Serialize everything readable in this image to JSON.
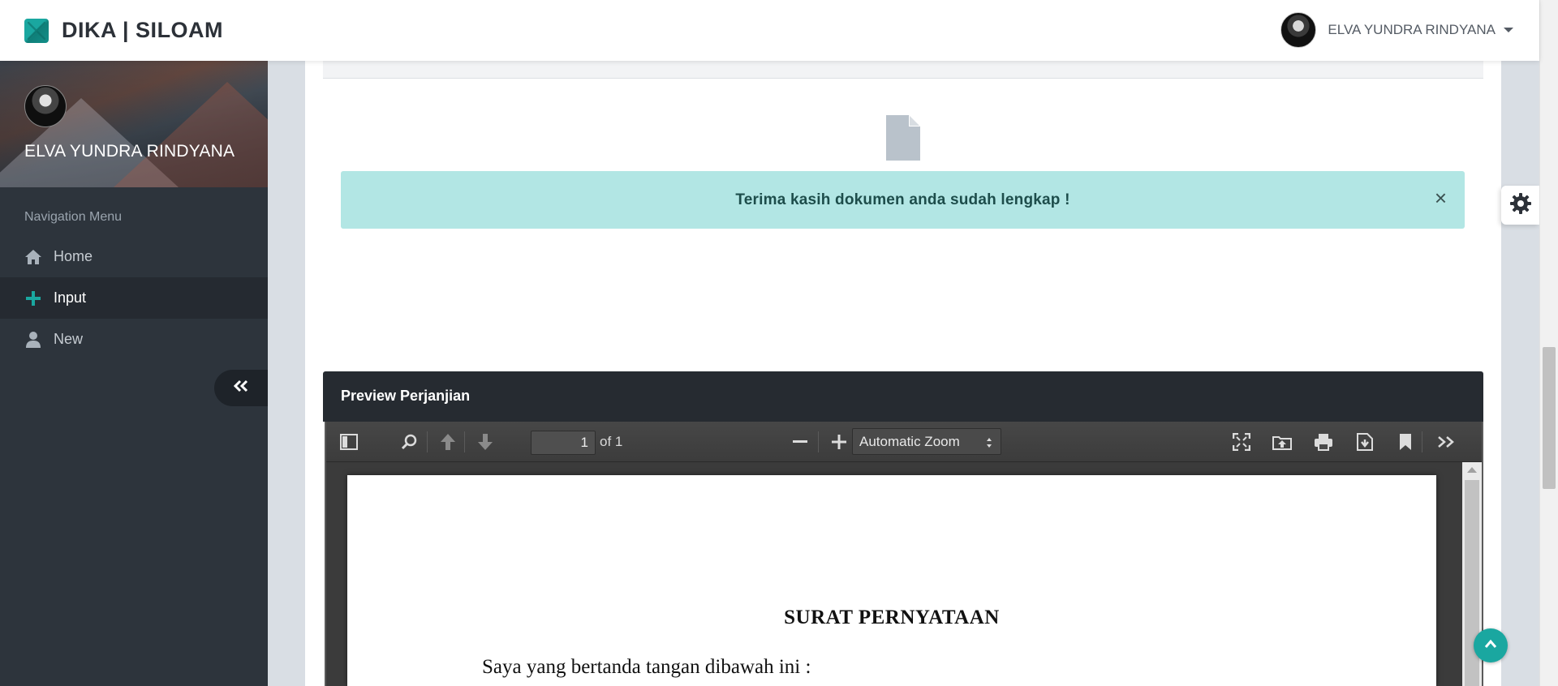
{
  "header": {
    "brand": "DIKA | SILOAM",
    "user_name": "ELVA YUNDRA RINDYANA"
  },
  "sidebar": {
    "profile_name": "ELVA YUNDRA RINDYANA",
    "nav_title": "Navigation Menu",
    "items": [
      {
        "label": "Home",
        "icon": "home-icon",
        "active": false
      },
      {
        "label": "Input",
        "icon": "plus-icon",
        "active": true
      },
      {
        "label": "New",
        "icon": "user-icon",
        "active": false
      }
    ],
    "collapse_icon": "double-chevron-left-icon"
  },
  "main": {
    "alert": {
      "message": "Terima kasih dokumen anda sudah lengkap !",
      "close_symbol": "×",
      "color": "#b2e6e4"
    },
    "preview": {
      "title": "Preview Perjanjian"
    }
  },
  "pdf_viewer": {
    "current_page": "1",
    "page_count_label": "of 1",
    "zoom": "Automatic Zoom",
    "document": {
      "title": "SURAT PERNYATAAN",
      "first_line": "Saya yang bertanda tangan dibawah ini :"
    }
  },
  "colors": {
    "accent": "#1aa7a0",
    "sidebar_bg": "#2d343c",
    "preview_header_bg": "#262b31"
  }
}
